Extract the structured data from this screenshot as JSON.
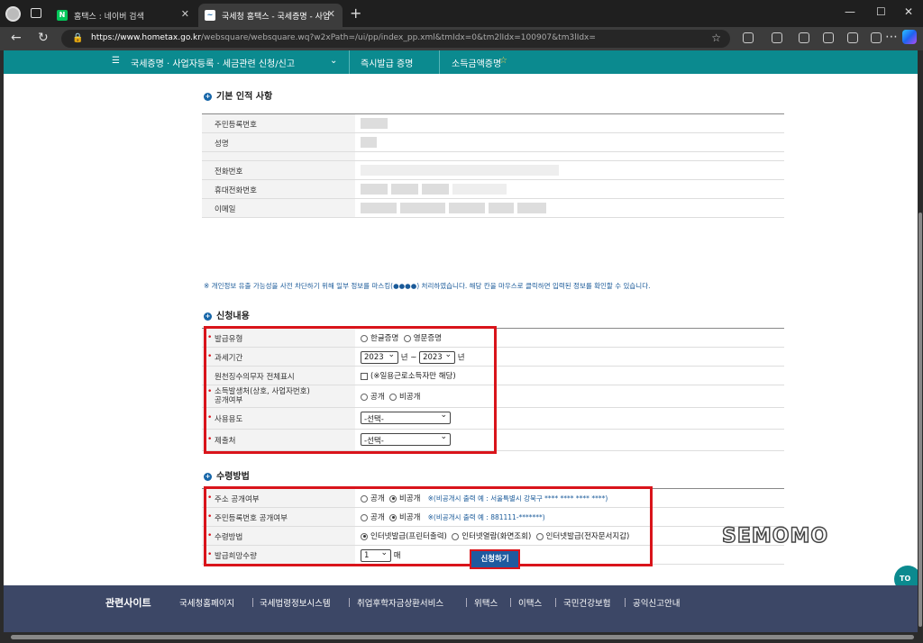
{
  "browser": {
    "tabs": [
      {
        "favicon": "N",
        "label": "홈택스 : 네이버 검색"
      },
      {
        "favicon": "~",
        "label": "국세청 홈택스 - 국세증명 - 사업"
      }
    ],
    "url_host": "https://www.hometax.go.kr",
    "url_path": "/websquare/websquare.wq?w2xPath=/ui/pp/index_pp.xml&tmIdx=0&tm2lIdx=100907&tm3lIdx="
  },
  "nav": {
    "menu": "국세증명 · 사업자등록 · 세금관련 신청/신고",
    "crumb1": "즉시발급 증명",
    "crumb2": "소득금액증명"
  },
  "basic": {
    "title": "기본 인적 사항",
    "rows": [
      "주민등록번호",
      "성명",
      "",
      "전화번호",
      "휴대전화번호",
      "이메일"
    ],
    "notice": "※ 개인정보 유출 가능성을 사전 차단하기 위해 일부 정보를 마스킹(●●●●) 처리하였습니다. 해당 칸을 마우스로 클릭하면 입력된 정보를 확인할 수 있습니다."
  },
  "apply": {
    "title": "신청내용",
    "issue_type_label": "발급유형",
    "issue_type_opt1": "한글증명",
    "issue_type_opt2": "영문증명",
    "period_label": "과세기간",
    "period_from": "2023",
    "period_to": "2023",
    "unit_year": "년",
    "tilde": "~",
    "withholding_label": "원천징수의무자 전체표시",
    "withholding_check": "(※일용근로소득자만 해당)",
    "source_label_1": "소득발생처(상호, 사업자번호)",
    "source_label_2": "공개여부",
    "open": "공개",
    "closed": "비공개",
    "usage_label": "사용용도",
    "usage_value": "-선택-",
    "submit_to_label": "제출처",
    "submit_to_value": "-선택-"
  },
  "receive": {
    "title": "수령방법",
    "addr_label": "주소 공개여부",
    "addr_note": "※(비공개시 출력 예 : 서울특별시 강북구 **** **** **** ****)",
    "rrn_label": "주민등록번호 공개여부",
    "rrn_note": "※(비공개시 출력 예 : 881111-*******)",
    "method_label": "수령방법",
    "method_opt1": "인터넷발급(프린터출력)",
    "method_opt2": "인터넷열람(화면조회)",
    "method_opt3": "인터넷발급(전자문서지갑)",
    "qty_label": "발급희망수량",
    "qty_value": "1",
    "qty_unit": "매"
  },
  "submit_button": "신청하기",
  "watermark": "SEMOMO",
  "top_button": "TO",
  "footer": {
    "title": "관련사이트",
    "links": [
      "국세청홈페이지",
      "국세법령정보시스템",
      "취업후학자금상환서비스",
      "위택스",
      "이택스",
      "국민건강보험",
      "공익신고안내"
    ]
  },
  "colors": {
    "nav": "#0b8a8f",
    "highlight": "#d9141b",
    "button": "#1f5a9f",
    "footer": "#3c4766"
  }
}
